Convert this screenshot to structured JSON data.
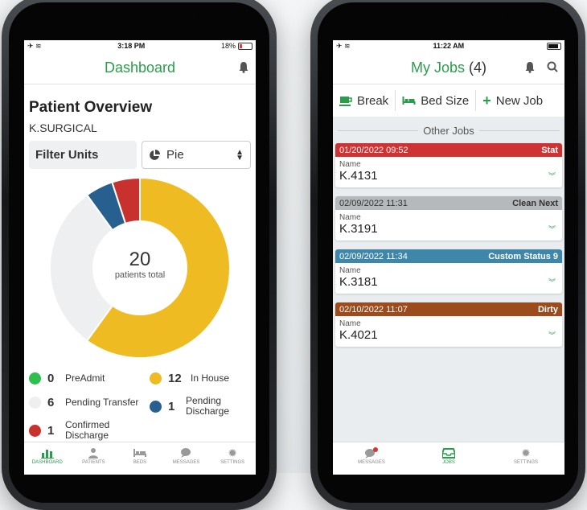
{
  "left_phone": {
    "status": {
      "time": "3:18 PM",
      "battery": "18%"
    },
    "nav_title": "Dashboard",
    "heading": "Patient Overview",
    "unit": "K.SURGICAL",
    "filter_label": "Filter Units",
    "chart_select": "Pie",
    "total": "20",
    "total_label": "patients total",
    "chart_data": {
      "type": "pie",
      "values": [
        12,
        6,
        1,
        1,
        0
      ],
      "categories": [
        "In House",
        "Pending Transfer",
        "Pending Discharge",
        "Confirmed Discharge",
        "PreAdmit"
      ],
      "colors": [
        "#efbb22",
        "#eeeff1",
        "#275f8f",
        "#c8322e",
        "#2ec04f"
      ]
    },
    "legend": {
      "preadmit": {
        "num": "0",
        "label": "PreAdmit",
        "color": "#2ec04f"
      },
      "inhouse": {
        "num": "12",
        "label": "In House",
        "color": "#efbb22"
      },
      "pending_transfer": {
        "num": "6",
        "label": "Pending Transfer",
        "color": "#eeeff1"
      },
      "pending_discharge": {
        "num": "1",
        "label_1": "Pending",
        "label_2": "Discharge",
        "color": "#275f8f"
      },
      "confirmed_discharge": {
        "num": "1",
        "label_1": "Confirmed",
        "label_2": "Discharge",
        "color": "#c8322e"
      }
    },
    "tabs": [
      "DASHBOARD",
      "PATIENTS",
      "BEDS",
      "MESSAGES",
      "SETTINGS"
    ]
  },
  "right_phone": {
    "status": {
      "time": "11:22 AM"
    },
    "nav_title": "My Jobs",
    "nav_count": "(4)",
    "toolbar": {
      "break": "Break",
      "bed_size": "Bed Size",
      "new_job": "New Job"
    },
    "section": "Other Jobs",
    "jobs": [
      {
        "date": "01/20/2022 09:52",
        "status": "Stat",
        "name_label": "Name",
        "name": "K.4131",
        "color": "#cf3232"
      },
      {
        "date": "02/09/2022 11:31",
        "status": "Clean Next",
        "name_label": "Name",
        "name": "K.3191",
        "color": "#b6b9bb"
      },
      {
        "date": "02/09/2022 11:34",
        "status": "Custom Status 9",
        "name_label": "Name",
        "name": "K.3181",
        "color": "#3e87a8"
      },
      {
        "date": "02/10/2022 11:07",
        "status": "Dirty",
        "name_label": "Name",
        "name": "K.4021",
        "color": "#9c4c1c"
      }
    ],
    "tabs": [
      "MESSAGES",
      "JOBS",
      "SETTINGS"
    ]
  },
  "colors": {
    "accent": "#2a9d4b"
  }
}
